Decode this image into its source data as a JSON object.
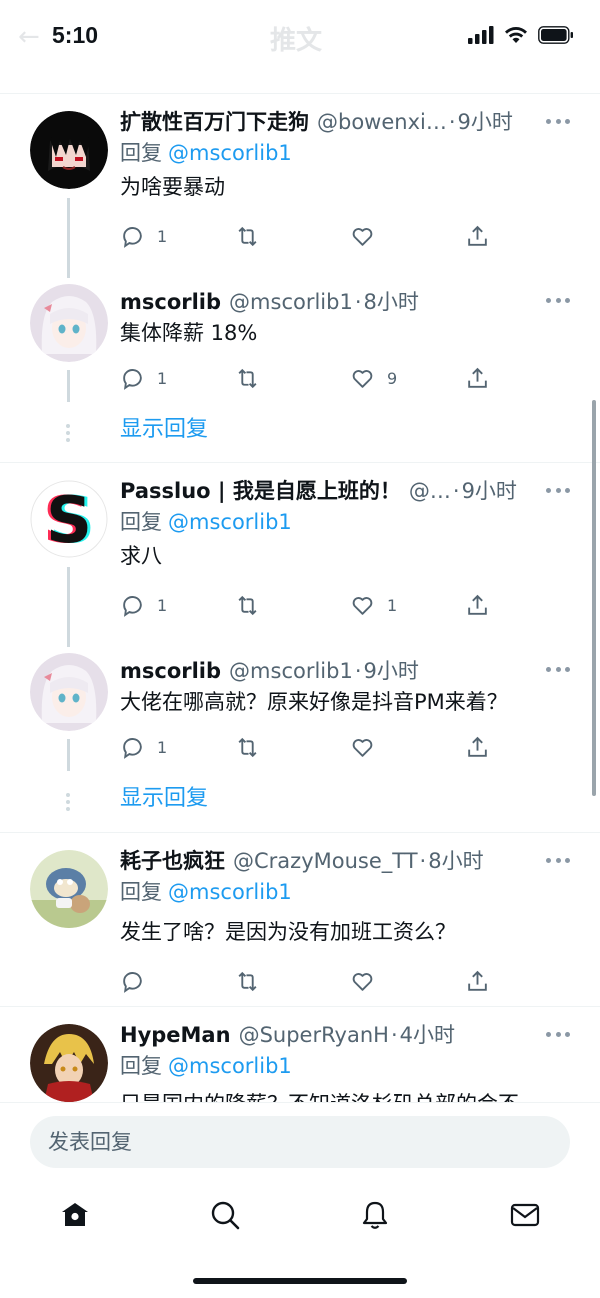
{
  "status_bar": {
    "time": "5:10"
  },
  "header": {
    "title_ghost": "推文"
  },
  "thread": [
    {
      "kind": "group",
      "tweets": [
        {
          "name": "扩散性百万门下走狗",
          "handle": "@bowenxi…",
          "ago": "9小时",
          "reply_to_label": "回复",
          "reply_to": "@mscorlib1",
          "text": "为啥要暴动",
          "replies": "1",
          "retweets": "",
          "likes": ""
        },
        {
          "name": "mscorlib",
          "handle": "@mscorlib1",
          "ago": "8小时",
          "text": "集体降薪 18%",
          "replies": "1",
          "retweets": "",
          "likes": "9"
        }
      ],
      "show_replies": "显示回复"
    },
    {
      "kind": "group",
      "tweets": [
        {
          "name": "Passluo | 我是自愿上班的！",
          "handle": "@…",
          "ago": "9小时",
          "reply_to_label": "回复",
          "reply_to": "@mscorlib1",
          "text": "求八",
          "replies": "1",
          "retweets": "",
          "likes": "1"
        },
        {
          "name": "mscorlib",
          "handle": "@mscorlib1",
          "ago": "9小时",
          "text": "大佬在哪高就？原来好像是抖音PM来着？",
          "replies": "1",
          "retweets": "",
          "likes": ""
        }
      ],
      "show_replies": "显示回复"
    },
    {
      "kind": "single",
      "tweets": [
        {
          "name": "耗子也疯狂",
          "handle": "@CrazyMouse_TT",
          "ago": "8小时",
          "reply_to_label": "回复",
          "reply_to": "@mscorlib1",
          "text": "发生了啥？是因为没有加班工资么？",
          "replies": "",
          "retweets": "",
          "likes": ""
        }
      ]
    },
    {
      "kind": "single",
      "tweets": [
        {
          "name": "HypeMan",
          "handle": "@SuperRyanH",
          "ago": "4小时",
          "reply_to_label": "回复",
          "reply_to": "@mscorlib1",
          "text": "只是国内的降薪？不知道洛杉矶总部的会不"
        }
      ]
    }
  ],
  "composer": {
    "placeholder": "发表回复"
  },
  "tabs": [
    "home",
    "search",
    "notifications",
    "messages"
  ],
  "colors": {
    "accent": "#1d9bf0",
    "muted": "#536471",
    "text": "#0f1419"
  }
}
